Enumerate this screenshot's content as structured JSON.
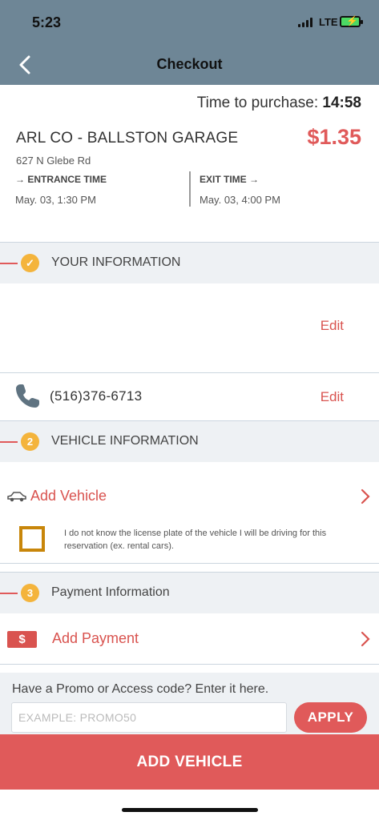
{
  "status_bar": {
    "time": "5:23",
    "network": "LTE",
    "battery_color": "#4cd964"
  },
  "nav": {
    "title": "Checkout"
  },
  "timer": {
    "label": "Time to purchase:",
    "value": "14:58"
  },
  "garage": {
    "name": "ARL CO - BALLSTON GARAGE",
    "price": "$1.35",
    "address": "627 N Glebe Rd",
    "entrance_label": "→ ENTRANCE TIME",
    "entrance_value": "May. 03, 1:30 PM",
    "exit_label": "EXIT TIME →",
    "exit_value": "May. 03, 4:00 PM"
  },
  "your_info": {
    "title": "YOUR INFORMATION",
    "badge": "✓",
    "edit_label": "Edit",
    "phone": "(516)376-6713",
    "phone_edit_label": "Edit"
  },
  "vehicle_info": {
    "step": "2",
    "title": "VEHICLE INFORMATION",
    "add_vehicle": "Add Vehicle",
    "license_note": "I do not know the license plate of the vehicle I will be driving for this reservation (ex. rental cars)."
  },
  "payment_info": {
    "step": "3",
    "title": "Payment Information",
    "icon_text": "$",
    "add_payment": "Add Payment"
  },
  "promo": {
    "label": "Have a Promo or Access code? Enter it here.",
    "placeholder": "EXAMPLE: PROMO50",
    "apply_label": "APPLY"
  },
  "cta": {
    "label": "ADD VEHICLE"
  },
  "colors": {
    "accent": "#e05a5a",
    "header": "#6e8696",
    "badge": "#f4b43c",
    "checkbox_border": "#c8860a"
  }
}
